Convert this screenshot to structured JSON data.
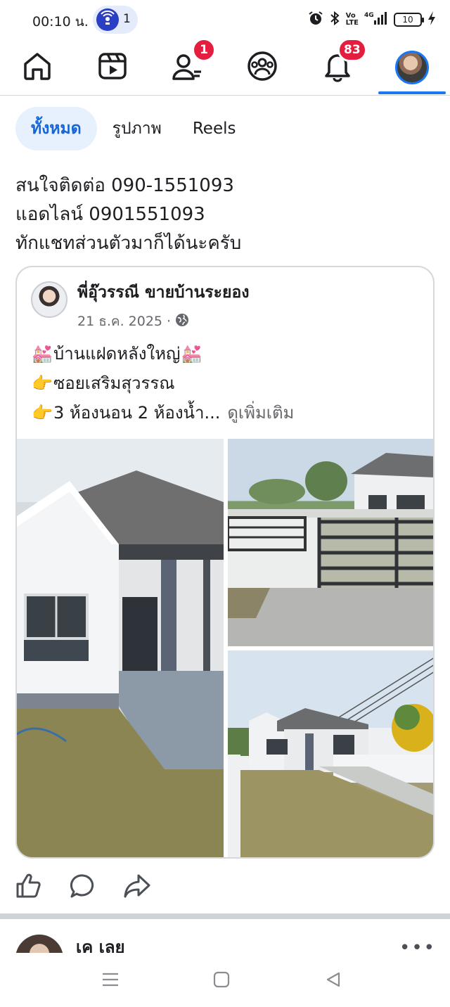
{
  "status_bar": {
    "time": "00:10 น.",
    "hotspot_count": "1",
    "battery": "10",
    "network_label": "4G"
  },
  "nav": {
    "items": [
      {
        "icon": "home-icon"
      },
      {
        "icon": "reels-video-icon"
      },
      {
        "icon": "friends-icon",
        "badge": "1"
      },
      {
        "icon": "groups-icon"
      },
      {
        "icon": "notifications-bell-icon",
        "badge": "83"
      },
      {
        "icon": "profile-avatar"
      }
    ],
    "accent_color": "#1877f2",
    "badge_color": "#e41e3f"
  },
  "filters": {
    "tabs": [
      "ทั้งหมด",
      "รูปภาพ",
      "Reels"
    ],
    "selected": "ทั้งหมด"
  },
  "caption": {
    "lines": [
      "สนใจติดต่อ 090-1551093",
      "แอดไลน์ 0901551093",
      "ทักแชทส่วนตัวมาก็ได้นะครับ"
    ]
  },
  "shared_post": {
    "author": "พี่อุ๊วรรณี ขายบ้านระยอง",
    "date": "21 ธ.ค. 2025",
    "separator": "·",
    "privacy_icon": "globe-icon",
    "lines": [
      {
        "prefix": "💒",
        "text": "บ้านแฝดหลังใหญ่",
        "suffix": "💒"
      },
      {
        "prefix": "👉",
        "text": "ซอยเสริมสุวรรณ"
      },
      {
        "prefix": "👉",
        "text": "3 ห้องนอน 2 ห้องน้ำ...",
        "see_more": "ดูเพิ่มเติม"
      }
    ],
    "photos": [
      "house-front-photo",
      "house-gate-photo",
      "house-yard-photo"
    ]
  },
  "actions": [
    "like-icon",
    "comment-icon",
    "share-icon"
  ],
  "next_post": {
    "author": "เค เลย",
    "more": "•••"
  },
  "system_nav": [
    "recent-apps-icon",
    "home-button-icon",
    "back-icon"
  ]
}
